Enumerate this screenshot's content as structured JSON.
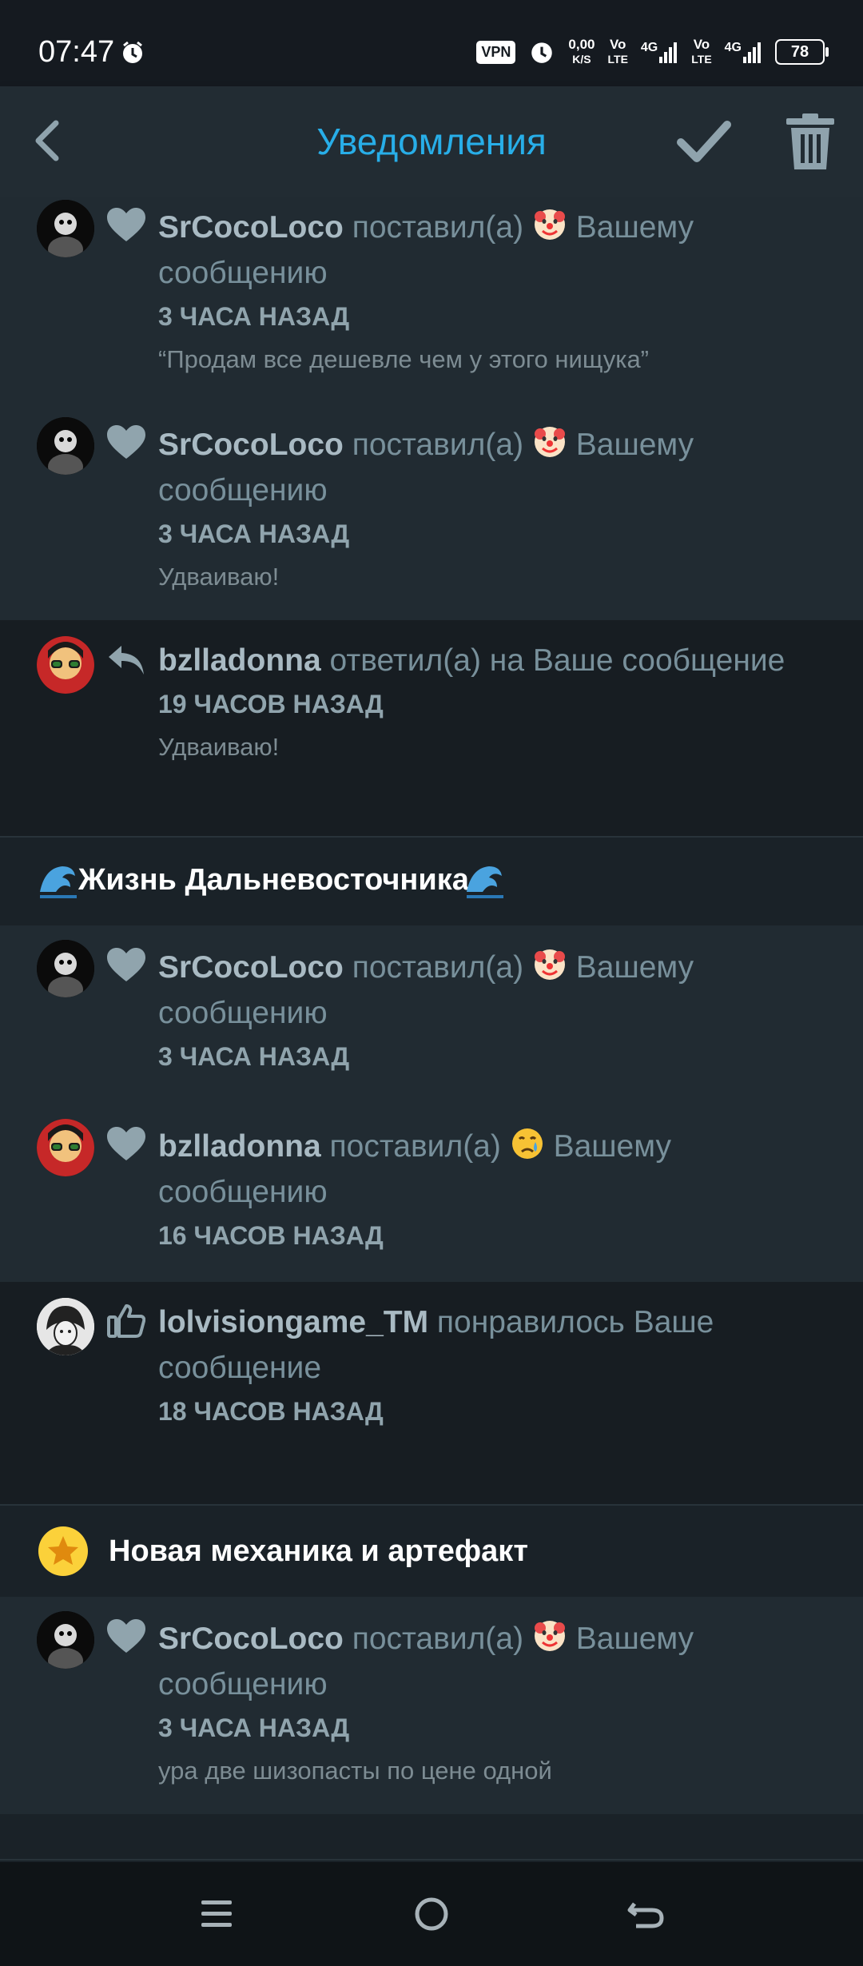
{
  "status_bar": {
    "time": "07:47",
    "vpn": "VPN",
    "speed_value": "0,00",
    "speed_unit": "K/S",
    "net1_a": "Vo",
    "net1_b": "LTE",
    "net1_4g": "4G",
    "net2_a": "Vo",
    "net2_b": "LTE",
    "net2_4g": "4G",
    "battery": "78"
  },
  "app_bar": {
    "title": "Уведомления",
    "title_color": "#28aee8"
  },
  "groups": [
    {
      "title": "",
      "notifications": [
        {
          "user": "SrCocoLoco",
          "action": "поставил(а)",
          "emoji": "clown-face-emoji",
          "target": "Вашему сообщению",
          "line2": "сообщению",
          "time": "3 ЧАСА НАЗАД",
          "quote": "“Продам все дешевле чем у этого нищука”",
          "icon": "heart-icon"
        },
        {
          "user": "SrCocoLoco",
          "action": "поставил(а)",
          "emoji": "clown-face-emoji",
          "target": "Вашему",
          "line2": "сообщению",
          "time": "3 ЧАСА НАЗАД",
          "quote": "Удваиваю!",
          "icon": "heart-icon"
        },
        {
          "user": "bzlladonna",
          "action": "ответил(а) на Ваше сообщение",
          "time": "19 ЧАСОВ НАЗАД",
          "quote": "Удваиваю!",
          "icon": "reply-icon"
        }
      ]
    },
    {
      "title": "Жизнь Дальневосточника",
      "notifications": [
        {
          "user": "SrCocoLoco",
          "action": "поставил(а)",
          "emoji": "clown-face-emoji",
          "target": "Вашему",
          "line2": "сообщению",
          "time": "3 ЧАСА НАЗАД",
          "icon": "heart-icon"
        },
        {
          "user": "bzlladonna",
          "action": "поставил(а)",
          "emoji": "crying-face-emoji",
          "target": "Вашему",
          "line2": "сообщению",
          "time": "16 ЧАСОВ НАЗАД",
          "icon": "heart-icon"
        },
        {
          "user": "lolvisiongame_TM",
          "action": "понравилось Ваше",
          "line2": "сообщение",
          "time": "18 ЧАСОВ НАЗАД",
          "icon": "thumbs-up-icon"
        }
      ]
    },
    {
      "title": "Новая механика и артефакт",
      "notifications": [
        {
          "user": "SrCocoLoco",
          "action": "поставил(а)",
          "emoji": "clown-face-emoji",
          "target": "Вашему",
          "line2": "сообщению",
          "time": "3 ЧАСА НАЗАД",
          "quote": "ура две шизопасты по цене одной",
          "icon": "heart-icon"
        }
      ]
    }
  ]
}
